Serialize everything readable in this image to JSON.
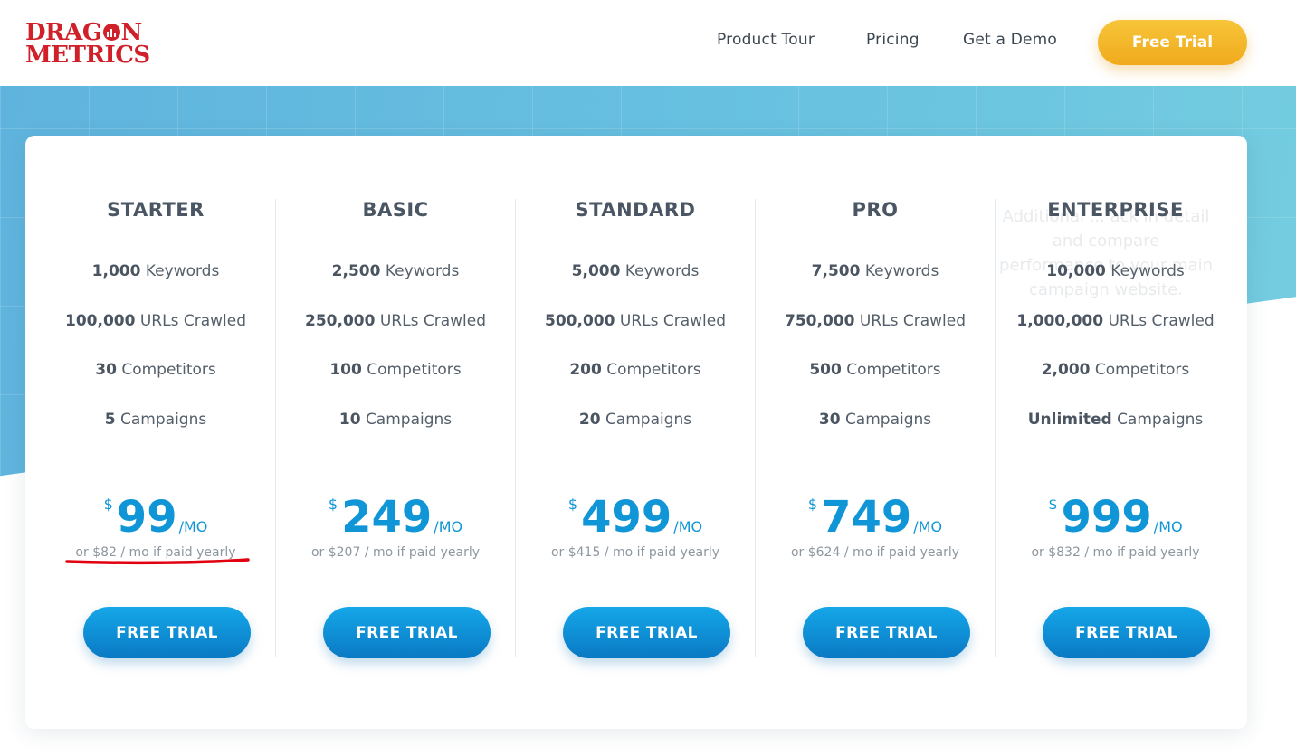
{
  "header": {
    "logo_line1": "DRAG",
    "logo_line1_end": "N",
    "logo_line2": "METRICS",
    "nav": [
      "Product Tour",
      "Pricing",
      "Get a Demo"
    ],
    "cta_label": "Free Trial"
  },
  "colors": {
    "brand_red": "#d0202a",
    "cta_yellow": "#f3b62a",
    "price_blue": "#1096d6",
    "button_blue": "#0f8fd8",
    "hero_blue": "#64bce0"
  },
  "background_text": "Additional ... ack in detail and compare performance to your main campaign website.",
  "plans": [
    {
      "name": "STARTER",
      "keywords_count": "1,000",
      "keywords_label": "Keywords",
      "urls_count": "100,000",
      "urls_label": "URLs Crawled",
      "competitors_count": "30",
      "competitors_label": "Competitors",
      "campaigns_count": "5",
      "campaigns_label": "Campaigns",
      "currency": "$",
      "price": "99",
      "period": "/MO",
      "yearly": "or $82 / mo if paid yearly",
      "button": "FREE TRIAL"
    },
    {
      "name": "BASIC",
      "keywords_count": "2,500",
      "keywords_label": "Keywords",
      "urls_count": "250,000",
      "urls_label": "URLs Crawled",
      "competitors_count": "100",
      "competitors_label": "Competitors",
      "campaigns_count": "10",
      "campaigns_label": "Campaigns",
      "currency": "$",
      "price": "249",
      "period": "/MO",
      "yearly": "or $207 / mo if paid yearly",
      "button": "FREE TRIAL"
    },
    {
      "name": "STANDARD",
      "keywords_count": "5,000",
      "keywords_label": "Keywords",
      "urls_count": "500,000",
      "urls_label": "URLs Crawled",
      "competitors_count": "200",
      "competitors_label": "Competitors",
      "campaigns_count": "20",
      "campaigns_label": "Campaigns",
      "currency": "$",
      "price": "499",
      "period": "/MO",
      "yearly": "or $415 / mo if paid yearly",
      "button": "FREE TRIAL"
    },
    {
      "name": "PRO",
      "keywords_count": "7,500",
      "keywords_label": "Keywords",
      "urls_count": "750,000",
      "urls_label": "URLs Crawled",
      "competitors_count": "500",
      "competitors_label": "Competitors",
      "campaigns_count": "30",
      "campaigns_label": "Campaigns",
      "currency": "$",
      "price": "749",
      "period": "/MO",
      "yearly": "or $624 / mo if paid yearly",
      "button": "FREE TRIAL"
    },
    {
      "name": "ENTERPRISE",
      "keywords_count": "10,000",
      "keywords_label": "Keywords",
      "urls_count": "1,000,000",
      "urls_label": "URLs Crawled",
      "competitors_count": "2,000",
      "competitors_label": "Competitors",
      "campaigns_count": "Unlimited",
      "campaigns_label": "Campaigns",
      "currency": "$",
      "price": "999",
      "period": "/MO",
      "yearly": "or $832 / mo if paid yearly",
      "button": "FREE TRIAL"
    }
  ]
}
